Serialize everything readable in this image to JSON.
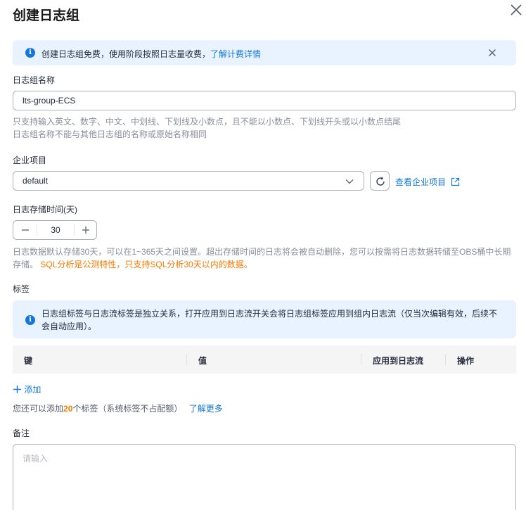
{
  "dialog": {
    "title": "创建日志组",
    "close_icon": "close-icon"
  },
  "notice": {
    "text": "创建日志组免费，使用阶段按照日志量收费，",
    "link": "了解计费详情"
  },
  "log_group_name": {
    "label": "日志组名称",
    "value": "lts-group-ECS",
    "hint_line1": "只支持输入英文、数字、中文、中划线、下划线及小数点，且不能以小数点、下划线开头或以小数点结尾",
    "hint_line2": "日志组名称不能与其他日志组的名称或原始名称相同"
  },
  "enterprise_project": {
    "label": "企业项目",
    "value": "default",
    "view_link": "查看企业项目"
  },
  "retention": {
    "label": "日志存储时间(天)",
    "value": "30",
    "hint_line1": "日志数据默认存储30天，可以在1~365天之间设置。超出存储时间的日志将会被自动删除，您可以按需将日志数据转储至OBS桶中长期",
    "hint_line2_plain": "存储。",
    "hint_line2_warn": "SQL分析是公测特性，只支持SQL分析30天以内的数据。"
  },
  "tags": {
    "label": "标签",
    "notice_line1": "日志组标签与日志流标签是独立关系，打开应用到日志流开关会将日志组标签应用到组内日志流（仅当次编辑有效，后续不",
    "notice_line2": "会自动应用）。",
    "columns": [
      "键",
      "值",
      "应用到日志流",
      "操作"
    ],
    "add_label": "添加",
    "quota_prefix": "您还可以添加",
    "quota_count": "20",
    "quota_suffix": "个标签（系统标签不占配额）",
    "learn_more": "了解更多"
  },
  "remark": {
    "label": "备注",
    "placeholder": "请输入"
  },
  "colors": {
    "accent": "#1476d9",
    "warning": "#fa7a00",
    "notice_bg": "#e8f3ff"
  }
}
